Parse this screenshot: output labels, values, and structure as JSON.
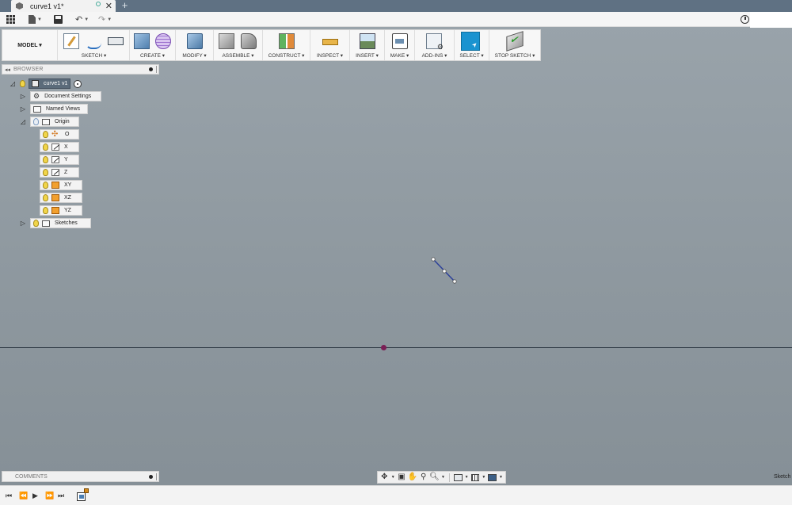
{
  "tab": {
    "title": "curve1 v1*",
    "close": "✕",
    "new": "+"
  },
  "quickbar": {
    "undo": "↶",
    "redo": "↷"
  },
  "toolbar": {
    "mode": "MODEL ▾",
    "groups": [
      {
        "label": "SKETCH ▾"
      },
      {
        "label": "CREATE ▾"
      },
      {
        "label": "MODIFY ▾"
      },
      {
        "label": "ASSEMBLE ▾"
      },
      {
        "label": "CONSTRUCT ▾"
      },
      {
        "label": "INSPECT ▾"
      },
      {
        "label": "INSERT ▾"
      },
      {
        "label": "MAKE ▾"
      },
      {
        "label": "ADD-INS ▾"
      },
      {
        "label": "SELECT ▾"
      },
      {
        "label": "STOP SKETCH ▾"
      }
    ]
  },
  "browser": {
    "title": "BROWSER",
    "root": "curve1 v1",
    "items": [
      {
        "label": "Document Settings"
      },
      {
        "label": "Named Views"
      },
      {
        "label": "Origin"
      },
      {
        "label": "O"
      },
      {
        "label": "X"
      },
      {
        "label": "Y"
      },
      {
        "label": "Z"
      },
      {
        "label": "XY"
      },
      {
        "label": "XZ"
      },
      {
        "label": "YZ"
      },
      {
        "label": "Sketches"
      }
    ]
  },
  "comments": {
    "title": "COMMENTS"
  },
  "status": {
    "sketch_label": "Sketch"
  },
  "colors": {
    "sketch_line": "#2b3f9a",
    "origin_point": "#7a1f55",
    "select_active": "#1a93d0",
    "tabbar": "#5f7183"
  }
}
